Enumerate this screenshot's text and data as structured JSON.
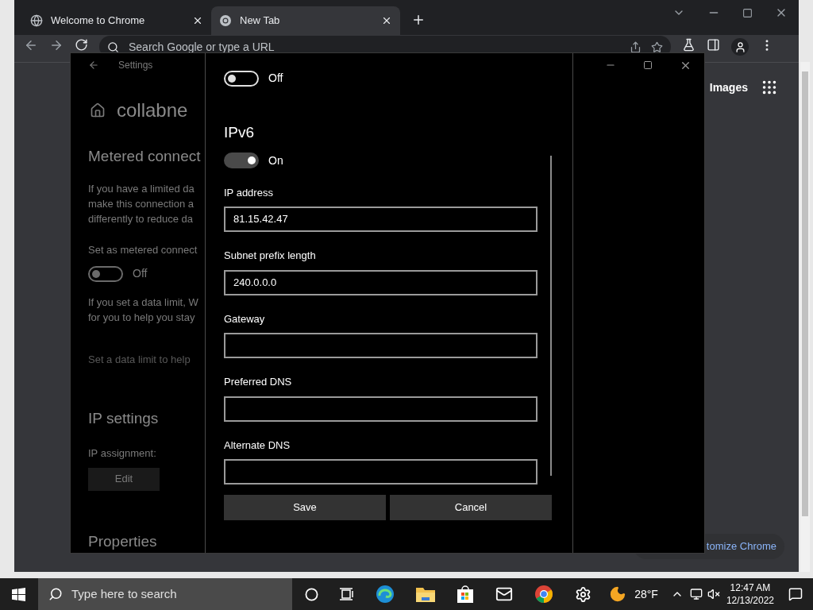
{
  "browser": {
    "tabs": [
      {
        "title": "Welcome to Chrome",
        "selected": false
      },
      {
        "title": "New Tab",
        "selected": true
      }
    ],
    "omnibox": {
      "placeholder": "Search Google or type a URL"
    },
    "page": {
      "images_link": "Images",
      "customize_button": "tomize Chrome"
    }
  },
  "settings_window": {
    "title": "Settings",
    "network_name": "collabne",
    "items": [
      {
        "kind": "heading",
        "text": "Metered connect"
      },
      {
        "kind": "paragraph",
        "lines": [
          "If you have a limited da",
          "make this connection a",
          "differently to reduce da"
        ]
      },
      {
        "kind": "label",
        "text": "Set as metered connect"
      },
      {
        "kind": "toggle",
        "on": false,
        "text": "Off"
      },
      {
        "kind": "paragraph",
        "lines": [
          "If you set a data limit, W",
          "for you to help you stay"
        ]
      },
      {
        "kind": "dim",
        "text": "Set a data limit to help"
      },
      {
        "kind": "heading",
        "text": "IP settings"
      },
      {
        "kind": "label",
        "text": "IP assignment:"
      },
      {
        "kind": "button",
        "text": "Edit"
      },
      {
        "kind": "heading",
        "text": "Properties"
      }
    ]
  },
  "dialog": {
    "items": [
      {
        "kind": "toggle",
        "on": false,
        "text": "Off"
      },
      {
        "kind": "heading",
        "text": "IPv6"
      },
      {
        "kind": "toggle",
        "on": true,
        "text": "On"
      },
      {
        "kind": "field",
        "label": "IP address",
        "value": "81.15.42.47"
      },
      {
        "kind": "field",
        "label": "Subnet prefix length",
        "value": "240.0.0.0"
      },
      {
        "kind": "field",
        "label": "Gateway"
      },
      {
        "kind": "field",
        "label": "Preferred DNS"
      },
      {
        "kind": "field",
        "label": "Alternate DNS"
      }
    ],
    "buttons": [
      "Save",
      "Cancel"
    ]
  },
  "taskbar": {
    "search_placeholder": "Type here to search",
    "temperature": "28°F",
    "time": "12:47 AM",
    "date": "12/13/2022"
  }
}
